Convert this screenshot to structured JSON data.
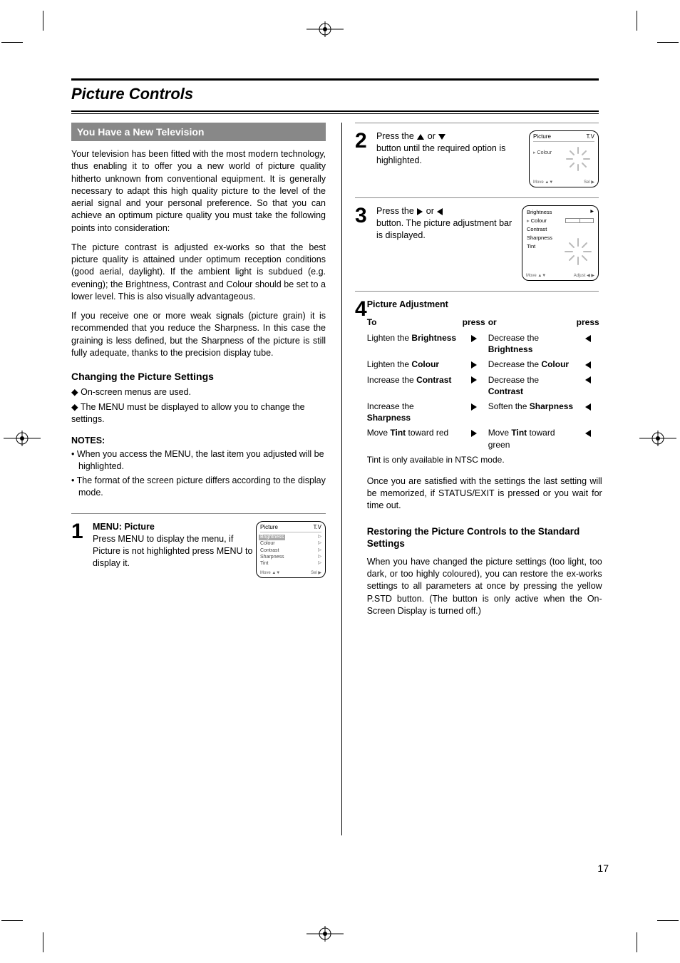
{
  "page": {
    "title": "Picture Controls",
    "number": "17"
  },
  "left_col": {
    "section_title": "You Have a New Television",
    "intro1": "Your television has been fitted with the most modern technology, thus enabling it to offer you a new world of picture quality hitherto unknown from conventional equipment. It is generally necessary to adapt this high quality picture to the level of the aerial signal and your personal preference. So that you can achieve an optimum picture quality you must take the following points into consideration:",
    "intro2": "The picture contrast is adjusted ex-works so that the best picture quality is attained under optimum reception conditions (good aerial, daylight). If the ambient light is subdued (e.g. evening); the Brightness, Contrast and Colour should be set to a lower level. This is also visually advantageous.",
    "intro3": "If you receive one or more weak signals (picture grain) it is recommended that you reduce the Sharpness. In this case the graining is less defined, but the Sharpness of the picture is still fully adequate, thanks to the precision display tube.",
    "subhead": "Changing the Picture Settings",
    "bullet1": "On-screen menus are used.",
    "bullet2": "The MENU must be displayed to allow you to change the settings.",
    "note_title": "NOTES:",
    "note1": "When you access the MENU, the last item you adjusted will be highlighted.",
    "note2": "The format of the screen picture differs according to the display mode.",
    "step1_label_1": "MENU: ",
    "step1_label_2": "Picture",
    "step1_body": "Press MENU to display the menu, if Picture is not highlighted press MENU to display it.",
    "step1_thumb": {
      "title_left": "Picture",
      "title_right": "T.V",
      "rows": [
        [
          "Brightness",
          "▷"
        ],
        [
          "Colour",
          "▷"
        ],
        [
          "Contrast",
          "▷"
        ],
        [
          "Sharpness",
          "▷"
        ],
        [
          "Tint",
          "▷"
        ]
      ],
      "highlighted_row": "Brightness",
      "bot_left": "Move ▲▼",
      "bot_right": "Sel ▶"
    }
  },
  "right_col": {
    "step2_text_1": "Press the ",
    "step2_text_2": " or ",
    "step2_text_3": " button until the required option is highlighted.",
    "step2_thumb": {
      "title_left": "Picture",
      "title_right": "T.V",
      "caret_row": "Colour",
      "bot_left": "Move ▲▼",
      "bot_right": "Sel ▶"
    },
    "step3_text_1": "Press the ",
    "step3_text_2": " or ",
    "step3_text_3": " button. The picture adjustment bar is displayed.",
    "step3_thumb": {
      "lines": [
        "Brightness",
        "Colour",
        "Contrast",
        "Sharpness",
        "Tint"
      ],
      "highlighted": "Colour",
      "bot_left": "Move ▲▼",
      "bot_right": "Adjust ◀ ▶"
    },
    "step4_heading": "Picture Adjustment",
    "adj_table": {
      "h_to": "To",
      "h_press": "press",
      "h_or": "or",
      "rows": [
        {
          "to_1": "Lighten the    ",
          "to_2": "Brightness",
          "dir1": "▶",
          "opp_1": "Decrease the  ",
          "opp_2": "Brightness",
          "dir2": "◀"
        },
        {
          "to_1": "Lighten the    ",
          "to_2": "Colour",
          "dir1": "▶",
          "opp_1": "Decrease the  ",
          "opp_2": "Colour",
          "dir2": "◀"
        },
        {
          "to_1": "Increase the   ",
          "to_2": "Contrast",
          "dir1": "▶",
          "opp_1": "Decrease the  ",
          "opp_2": "Contrast",
          "dir2": "◀"
        },
        {
          "to_1": "Increase the   ",
          "to_2": "Sharpness",
          "dir1": "▶",
          "opp_1": "Soften the    ",
          "opp_2": "Sharpness",
          "dir2": "◀"
        },
        {
          "to_1": "Move ",
          "to_2": "Tint",
          "to_3": " toward red",
          "dir1": "▶",
          "opp_1": "Move  ",
          "opp_2": "Tint",
          "opp_3": " toward green",
          "dir2": "◀"
        }
      ],
      "footnote": "Tint is only available in NTSC mode."
    },
    "post_adj": "Once you are satisfied with the settings the last setting will be memorized, if STATUS/EXIT is pressed or you wait for time out.",
    "restore_heading": "Restoring the Picture Controls to the Standard Settings",
    "restore_body": "When you have changed the picture settings (too light, too dark, or too highly coloured), you can restore the ex-works settings to all parameters at once by pressing the yellow P.STD button. (The button is only active when the On-Screen Display is turned off.)"
  }
}
